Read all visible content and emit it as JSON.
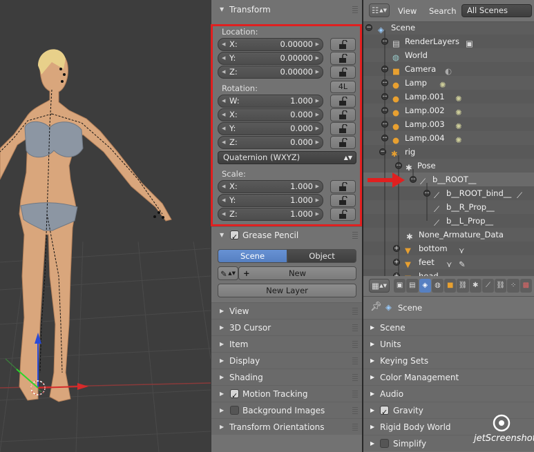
{
  "transform": {
    "title": "Transform",
    "location_label": "Location:",
    "location": [
      {
        "axis": "X:",
        "value": "0.00000"
      },
      {
        "axis": "Y:",
        "value": "0.00000"
      },
      {
        "axis": "Z:",
        "value": "0.00000"
      }
    ],
    "rotation_label": "Rotation:",
    "rotation_lock_button": "4L",
    "rotation": [
      {
        "axis": "W:",
        "value": "1.000"
      },
      {
        "axis": "X:",
        "value": "0.000"
      },
      {
        "axis": "Y:",
        "value": "0.000"
      },
      {
        "axis": "Z:",
        "value": "0.000"
      }
    ],
    "rotation_mode": "Quaternion (WXYZ)",
    "scale_label": "Scale:",
    "scale": [
      {
        "axis": "X:",
        "value": "1.000"
      },
      {
        "axis": "Y:",
        "value": "1.000"
      },
      {
        "axis": "Z:",
        "value": "1.000"
      }
    ]
  },
  "grease_pencil": {
    "title": "Grease Pencil",
    "tab_scene": "Scene",
    "tab_object": "Object",
    "new_label": "New",
    "new_layer_label": "New Layer"
  },
  "panels": [
    "View",
    "3D Cursor",
    "Item",
    "Display",
    "Shading",
    "Motion Tracking",
    "Background Images",
    "Transform Orientations"
  ],
  "outliner": {
    "menu_view": "View",
    "menu_search": "Search",
    "display_mode": "All Scenes",
    "items": [
      "Scene",
      "RenderLayers",
      "World",
      "Camera",
      "Lamp",
      "Lamp.001",
      "Lamp.002",
      "Lamp.003",
      "Lamp.004",
      "rig",
      "Pose",
      "b__ROOT__",
      "b__ROOT_bind__",
      "b__R_Prop__",
      "b__L_Prop__",
      "None_Armature_Data",
      "bottom",
      "feet",
      "head"
    ]
  },
  "properties": {
    "pinned": "Scene",
    "panels": [
      "Scene",
      "Units",
      "Keying Sets",
      "Color Management",
      "Audio",
      "Gravity",
      "Rigid Body World",
      "Simplify"
    ]
  },
  "watermark": "jetScreenshot",
  "colors": {
    "highlight": "#e02020",
    "active_tab": "#5680c2",
    "bone_icon": "#e8e8e8",
    "lamp_icon": "#e8a030"
  }
}
